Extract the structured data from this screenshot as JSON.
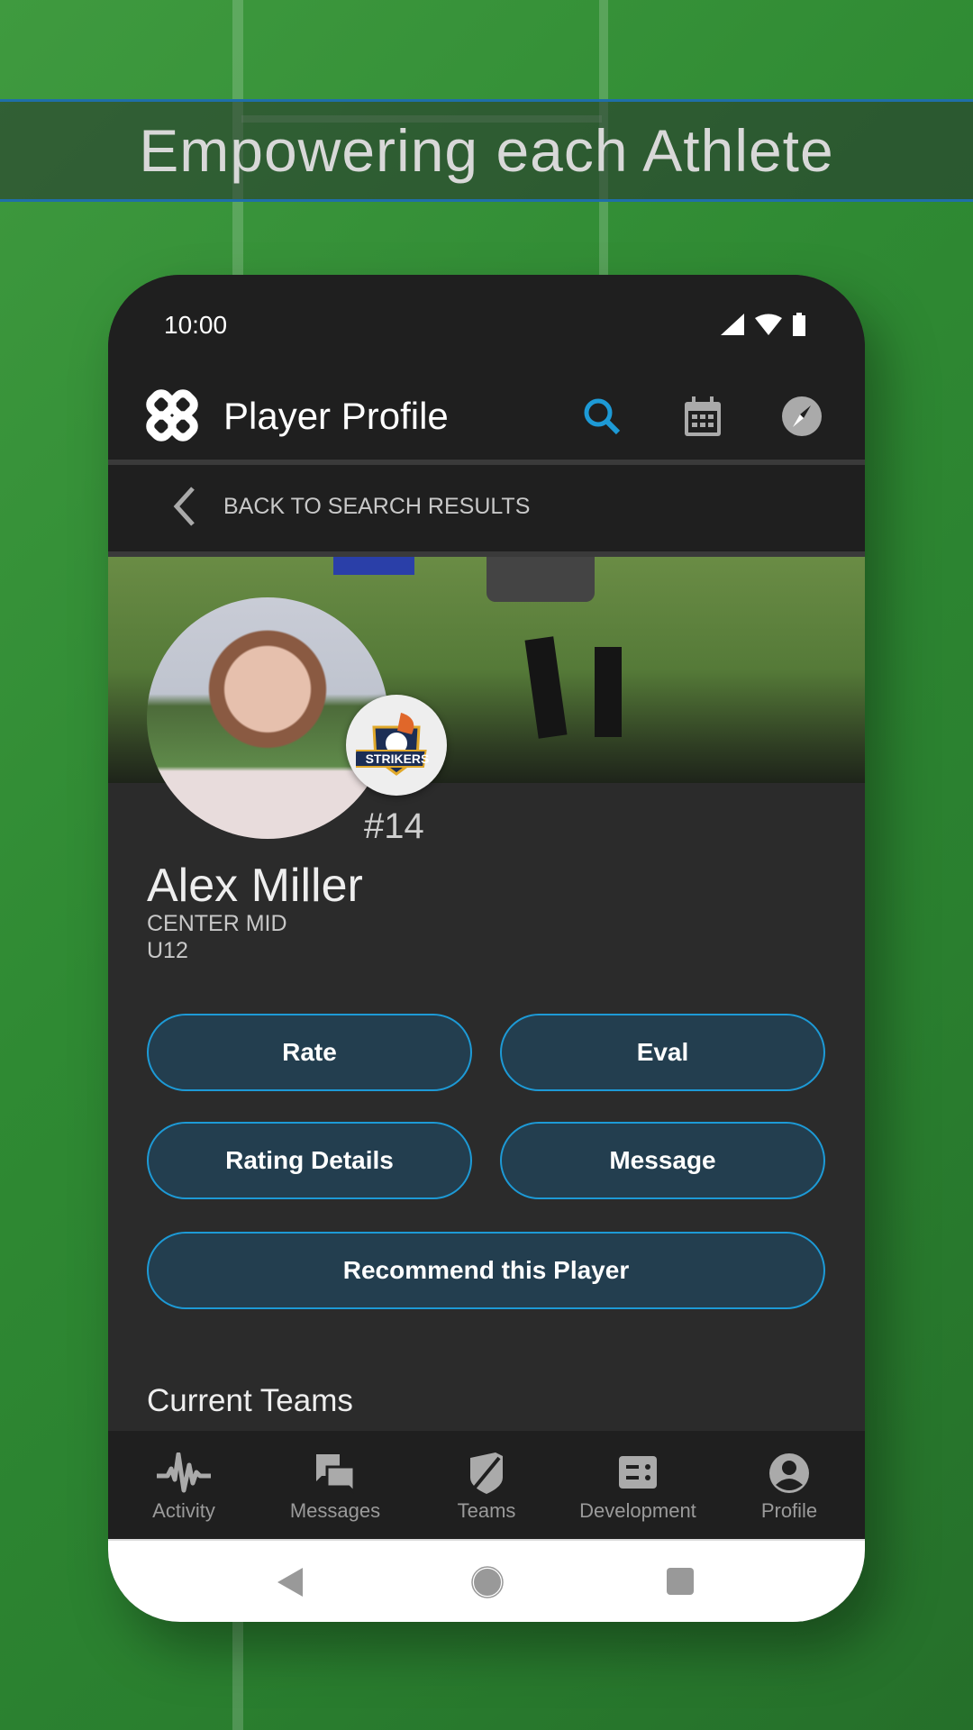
{
  "banner": {
    "title": "Empowering each Athlete"
  },
  "status_bar": {
    "time": "10:00",
    "icons": [
      "signal-icon",
      "wifi-icon",
      "battery-icon"
    ]
  },
  "app_bar": {
    "title": "Player Profile",
    "icons": [
      "search-icon",
      "calendar-icon",
      "compass-icon"
    ],
    "accent": "#1d9ad6"
  },
  "back": {
    "label": "BACK TO SEARCH RESULTS"
  },
  "player": {
    "jersey": "#14",
    "name": "Alex Miller",
    "position": "CENTER MID",
    "age_group": "U12",
    "team_logo": "STRIKERS"
  },
  "actions": {
    "rate": "Rate",
    "eval": "Eval",
    "rating_details": "Rating Details",
    "message": "Message",
    "recommend": "Recommend this Player"
  },
  "sections": {
    "current_teams": "Current Teams"
  },
  "bottom_nav": [
    {
      "label": "Activity",
      "icon": "activity-icon"
    },
    {
      "label": "Messages",
      "icon": "messages-icon"
    },
    {
      "label": "Teams",
      "icon": "teams-shield-icon"
    },
    {
      "label": "Development",
      "icon": "development-icon"
    },
    {
      "label": "Profile",
      "icon": "profile-icon"
    }
  ]
}
